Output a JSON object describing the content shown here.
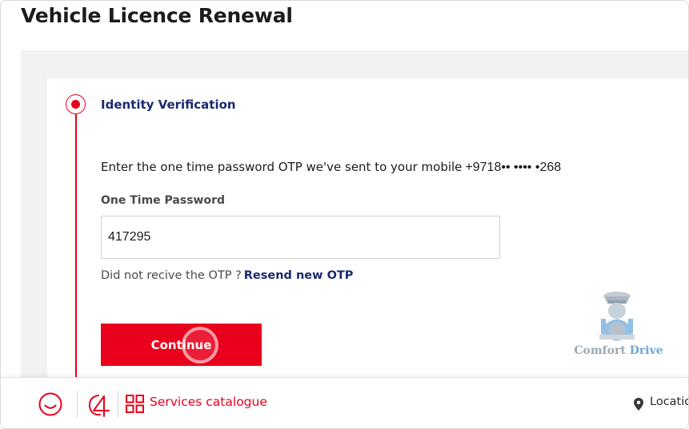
{
  "page": {
    "title": "Vehicle Licence Renewal"
  },
  "step": {
    "title": "Identity Verification"
  },
  "otp": {
    "message": "Enter the one time password OTP we've sent to your mobile",
    "phone": "+9718•• •••• •268",
    "field_label": "One Time Password",
    "value": "417295",
    "resend_prompt": "Did not recive the OTP ?",
    "resend_link": "Resend new OTP",
    "continue_label": "Continue"
  },
  "watermark": {
    "word1": "Comfort",
    "word2": "Drive"
  },
  "bottom_nav": {
    "services_label": "Services catalogue",
    "location_label": "Locatio"
  },
  "colors": {
    "accent": "#e8001c",
    "link": "#1a2a6e"
  },
  "icons": [
    "smiley-icon",
    "services-swirl-icon",
    "grid-icon",
    "location-pin-icon"
  ]
}
